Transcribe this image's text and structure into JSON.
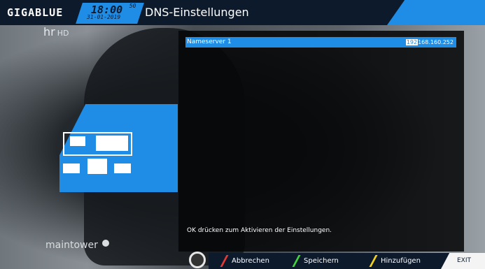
{
  "header": {
    "logo": "GIGABLUE",
    "time": "18:00",
    "seconds": "50",
    "date": "31-01-2019",
    "title": "DNS-Einstellungen"
  },
  "background": {
    "channel_logo": "hr",
    "channel_hd": "HD",
    "watermark": "maintower"
  },
  "panel": {
    "rows": [
      {
        "label": "Nameserver 1",
        "value_selected_segment": "192",
        "value_rest": "168.160.252"
      }
    ],
    "hint": "OK drücken zum Aktivieren der Einstellungen."
  },
  "footer": {
    "buttons": [
      {
        "label": "Abbrechen",
        "color": "#e53935"
      },
      {
        "label": "Speichern",
        "color": "#43d33a"
      },
      {
        "label": "Hinzufügen",
        "color": "#f2d21b"
      }
    ],
    "exit": "EXIT"
  },
  "colors": {
    "accent": "#1f8ce6",
    "navy": "#0d1a2c"
  }
}
